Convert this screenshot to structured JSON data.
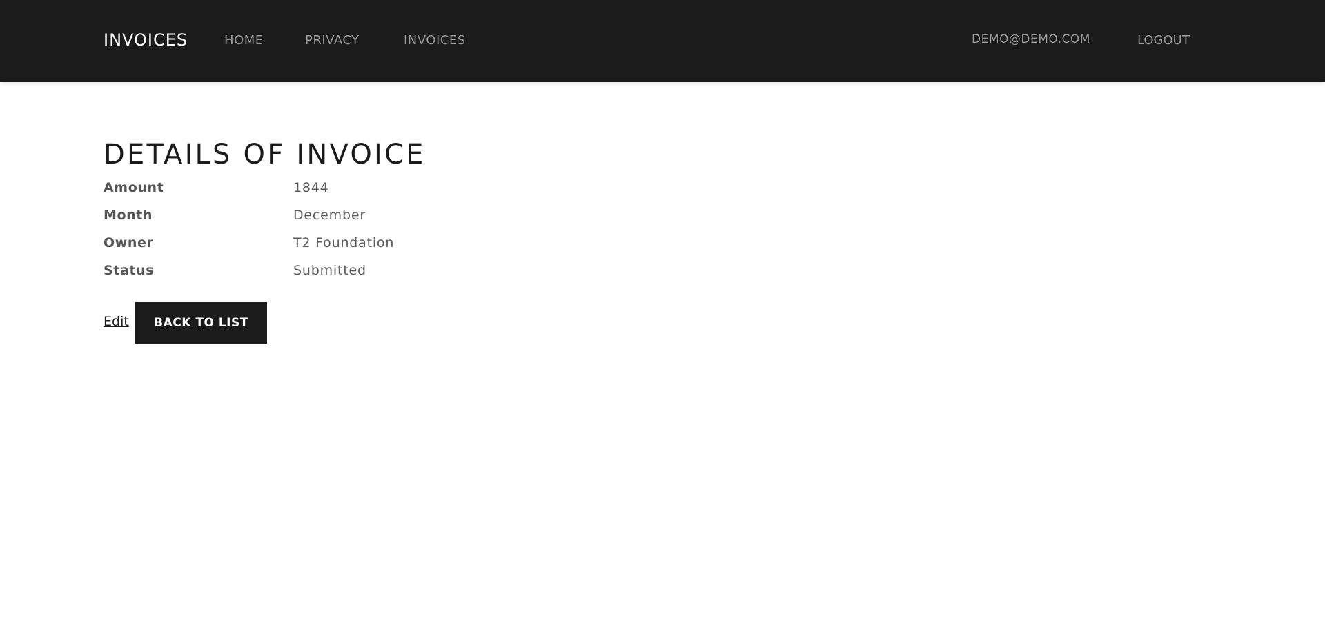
{
  "nav": {
    "brand": "INVOICES",
    "links": [
      "HOME",
      "PRIVACY",
      "INVOICES"
    ],
    "user": "DEMO@DEMO.COM",
    "logout": "LOGOUT"
  },
  "main": {
    "heading": "DETAILS OF INVOICE",
    "details": [
      {
        "label": "Amount",
        "value": "1844"
      },
      {
        "label": "Month",
        "value": "December"
      },
      {
        "label": "Owner",
        "value": "T2 Foundation"
      },
      {
        "label": "Status",
        "value": "Submitted"
      }
    ],
    "edit_label": "Edit",
    "back_label": "BACK TO LIST"
  },
  "colors": {
    "navbar_bg": "#1b1b1b",
    "nav_link": "#9a9a9a",
    "button_bg": "#1b1b1b",
    "button_text": "#ffffff"
  }
}
